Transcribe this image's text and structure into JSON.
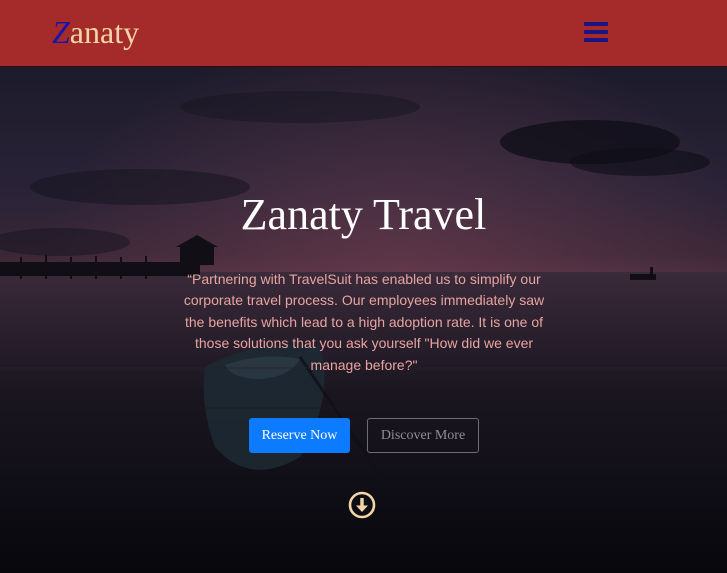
{
  "brand": {
    "initial": "Z",
    "rest": "anaty"
  },
  "nav": {
    "menu_icon": "hamburger-menu-icon"
  },
  "hero": {
    "title": "Zanaty Travel",
    "quote": "“Partnering with TravelSuit has enabled us to simplify our corporate travel process. Our employees immediately saw the benefits which lead to a high adoption rate. It is one of those solutions that you ask yourself \"How did we ever manage before?\"",
    "primary_button": "Reserve Now",
    "secondary_button": "Discover More",
    "scroll_icon": "arrow-circle-down-icon"
  },
  "colors": {
    "navbar": "#a52a2a",
    "brand_initial": "#1a14a8",
    "brand_text": "#f3d6a8",
    "menu_icon": "#1a1480",
    "quote_text": "#e9a3a0",
    "primary_button": "#0d7bff",
    "scroll_icon": "#f3d6a8"
  }
}
